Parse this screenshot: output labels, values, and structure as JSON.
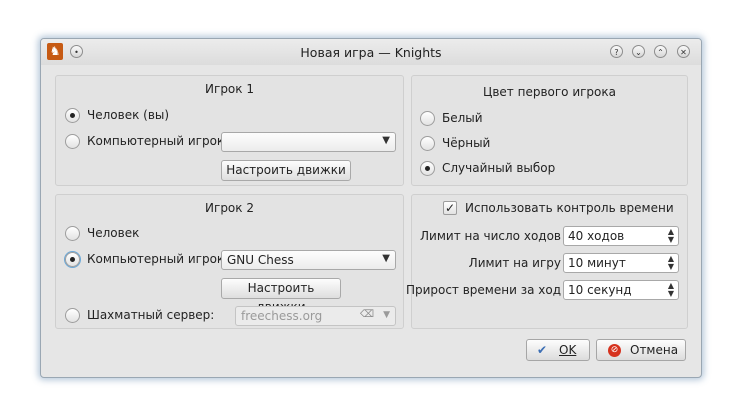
{
  "window": {
    "title": "Новая игра — Knights"
  },
  "player1": {
    "title": "Игрок 1",
    "human_label": "Человек (вы)",
    "computer_label": "Компьютерный игрок:",
    "computer_value": "",
    "configure_button": "Настроить движки",
    "selected": "human"
  },
  "player2": {
    "title": "Игрок 2",
    "human_label": "Человек",
    "computer_label": "Компьютерный игрок:",
    "computer_value": "GNU Chess",
    "configure_button": "Настроить движки",
    "server_label": "Шахматный сервер:",
    "server_value": "freechess.org",
    "selected": "computer"
  },
  "color": {
    "title": "Цвет первого игрока",
    "options": [
      "Белый",
      "Чёрный",
      "Случайный выбор"
    ],
    "selected": "Случайный выбор"
  },
  "time": {
    "use_label": "Использовать контроль времени",
    "use_checked": true,
    "moves_label": "Лимит на число ходов",
    "moves_value": "40 ходов",
    "game_label": "Лимит на игру",
    "game_value": "10 минут",
    "increment_label": "Прирост времени за ход",
    "increment_value": "10 секунд"
  },
  "buttons": {
    "ok": "OK",
    "cancel": "Отмена"
  },
  "icons": {
    "app": "knight-icon",
    "menu": "window-menu-icon",
    "help": "help-icon",
    "minimize": "minimize-icon",
    "maximize": "maximize-icon",
    "close": "close-icon",
    "ok": "checkmark-icon",
    "cancel": "cancel-icon",
    "clear": "clear-text-icon"
  },
  "colors": {
    "ok_icon": "#3c6eb4",
    "cancel_icon": "#d6321e",
    "window_glow": "#5a82aa"
  }
}
